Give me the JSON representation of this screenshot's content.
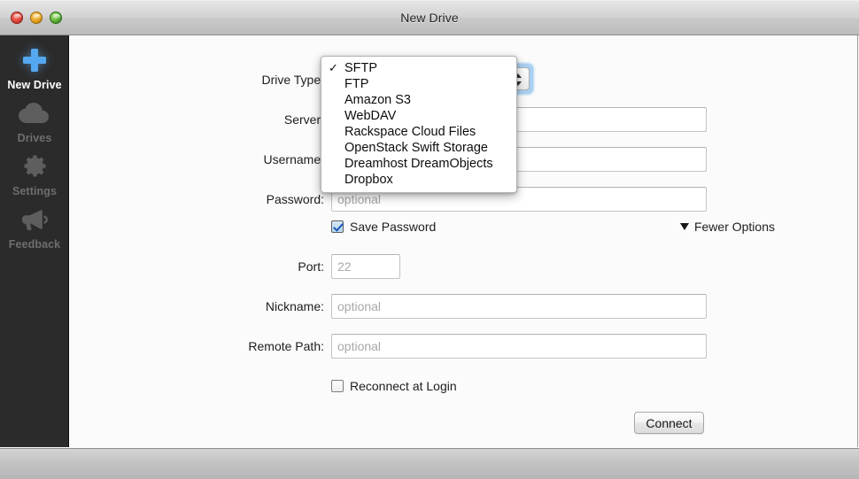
{
  "window": {
    "title": "New Drive",
    "traffic_lights": [
      "close-button",
      "minimize-button",
      "zoom-button"
    ]
  },
  "sidebar": {
    "items": [
      {
        "label": "New Drive",
        "icon": "plus-icon",
        "active": true
      },
      {
        "label": "Drives",
        "icon": "cloud-icon",
        "active": false
      },
      {
        "label": "Settings",
        "icon": "gear-icon",
        "active": false
      },
      {
        "label": "Feedback",
        "icon": "megaphone-icon",
        "active": false
      }
    ]
  },
  "form": {
    "drive_type": {
      "label": "Drive Type:",
      "selected": "SFTP",
      "options": [
        "SFTP",
        "FTP",
        "Amazon S3",
        "WebDAV",
        "Rackspace Cloud Files",
        "OpenStack Swift Storage",
        "Dreamhost DreamObjects",
        "Dropbox"
      ],
      "checkmark": "✓"
    },
    "server": {
      "label": "Server:",
      "value": "",
      "placeholder": ""
    },
    "username": {
      "label": "Username:",
      "value": "",
      "placeholder": ""
    },
    "password": {
      "label": "Password:",
      "value": "",
      "placeholder": "optional"
    },
    "port": {
      "label": "Port:",
      "value": "",
      "placeholder": "22"
    },
    "nickname": {
      "label": "Nickname:",
      "value": "",
      "placeholder": "optional"
    },
    "remote_path": {
      "label": "Remote Path:",
      "value": "",
      "placeholder": "optional"
    },
    "save_password": {
      "label": "Save Password",
      "checked": true
    },
    "reconnect_at_login": {
      "label": "Reconnect at Login",
      "checked": false
    },
    "fewer_options": {
      "label": "Fewer Options",
      "icon": "triangle-down-icon"
    },
    "connect": {
      "label": "Connect"
    }
  },
  "colors": {
    "accent": "#54a8ef",
    "sidebar_bg": "#2b2b2b",
    "content_bg": "#fbfbfb",
    "focus_ring": "#76b4ec"
  }
}
